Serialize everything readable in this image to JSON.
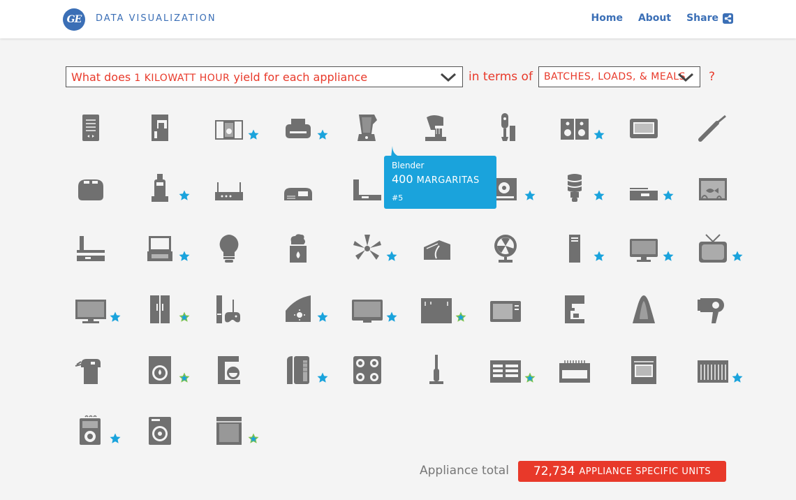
{
  "header": {
    "logo_text": "GE",
    "brand": "DATA VISUALIZATION",
    "nav": [
      {
        "label": "Home"
      },
      {
        "label": "About"
      },
      {
        "label": "Share"
      }
    ]
  },
  "question": {
    "select1": {
      "prefix": "What does ",
      "emph": "1 KILOWATT HOUR",
      "suffix": " yield for each appliance"
    },
    "middle": "in terms of",
    "select2": {
      "value": "BATCHES, LOADS, & MEALS"
    },
    "end": "?"
  },
  "colors": {
    "accent": "#e8392a",
    "brand": "#3b6fb6",
    "highlight": "#1aa3dc",
    "icon": "#707070",
    "star_outline": "#7fc34a"
  },
  "appliances": [
    {
      "icon": "e-reader-icon",
      "star": "none"
    },
    {
      "icon": "coffee-brewer-icon",
      "star": "none"
    },
    {
      "icon": "stereo-system-icon",
      "star": "filled"
    },
    {
      "icon": "printer-icon",
      "star": "filled"
    },
    {
      "icon": "blender-icon",
      "star": "none"
    },
    {
      "icon": "stand-mixer-icon",
      "star": "none"
    },
    {
      "icon": "hand-blender-icon",
      "star": "none"
    },
    {
      "icon": "speakers-icon",
      "star": "filled"
    },
    {
      "icon": "toaster-oven-icon",
      "star": "none"
    },
    {
      "icon": "curling-iron-icon",
      "star": "none"
    },
    {
      "icon": "toaster-icon",
      "star": "none"
    },
    {
      "icon": "cordless-phone-icon",
      "star": "filled"
    },
    {
      "icon": "wifi-router-icon",
      "star": "none"
    },
    {
      "icon": "alarm-clock-icon",
      "star": "none"
    },
    {
      "icon": "game-console-icon",
      "star": "none"
    },
    {
      "icon": "webcam-icon",
      "star": "none"
    },
    {
      "icon": "cd-player-icon",
      "star": "filled"
    },
    {
      "icon": "cfl-bulb-icon",
      "star": "filled"
    },
    {
      "icon": "cable-box-icon",
      "star": "filled"
    },
    {
      "icon": "aquarium-icon",
      "star": "none"
    },
    {
      "icon": "dvd-player-icon",
      "star": "none"
    },
    {
      "icon": "laptop-icon",
      "star": "filled"
    },
    {
      "icon": "light-bulb-icon",
      "star": "none"
    },
    {
      "icon": "humidifier-icon",
      "star": "none"
    },
    {
      "icon": "ceiling-fan-icon",
      "star": "filled"
    },
    {
      "icon": "waffle-iron-icon",
      "star": "none"
    },
    {
      "icon": "desk-fan-icon",
      "star": "none"
    },
    {
      "icon": "desktop-tower-icon",
      "star": "filled"
    },
    {
      "icon": "computer-monitor-icon",
      "star": "filled"
    },
    {
      "icon": "crt-tv-icon",
      "star": "filled"
    },
    {
      "icon": "lcd-tv-icon",
      "star": "filled"
    },
    {
      "icon": "refrigerator-icon",
      "star": "outline"
    },
    {
      "icon": "video-game-icon",
      "star": "none"
    },
    {
      "icon": "space-heater-icon",
      "star": "filled"
    },
    {
      "icon": "plasma-tv-icon",
      "star": "filled"
    },
    {
      "icon": "freezer-icon",
      "star": "outline"
    },
    {
      "icon": "microwave-icon",
      "star": "none"
    },
    {
      "icon": "espresso-machine-icon",
      "star": "none"
    },
    {
      "icon": "clothes-iron-icon",
      "star": "none"
    },
    {
      "icon": "hair-dryer-icon",
      "star": "none"
    },
    {
      "icon": "steam-cleaner-icon",
      "star": "none"
    },
    {
      "icon": "washing-machine-icon",
      "star": "outline"
    },
    {
      "icon": "drip-coffee-maker-icon",
      "star": "none"
    },
    {
      "icon": "water-heater-icon",
      "star": "filled"
    },
    {
      "icon": "cooktop-icon",
      "star": "none"
    },
    {
      "icon": "vacuum-icon",
      "star": "none"
    },
    {
      "icon": "electric-heater-icon",
      "star": "outline"
    },
    {
      "icon": "baseboard-heater-icon",
      "star": "none"
    },
    {
      "icon": "electric-oven-icon",
      "star": "none"
    },
    {
      "icon": "radiator-icon",
      "star": "filled"
    },
    {
      "icon": "dehumidifier-icon",
      "star": "filled"
    },
    {
      "icon": "clothes-dryer-icon",
      "star": "none"
    },
    {
      "icon": "dishwasher-icon",
      "star": "outline"
    }
  ],
  "tooltip": {
    "name": "Blender",
    "value": "400",
    "unit": "MARGARITAS",
    "rank": "#5"
  },
  "total": {
    "label": "Appliance total",
    "value": "72,734",
    "unit": "APPLIANCE SPECIFIC UNITS"
  }
}
